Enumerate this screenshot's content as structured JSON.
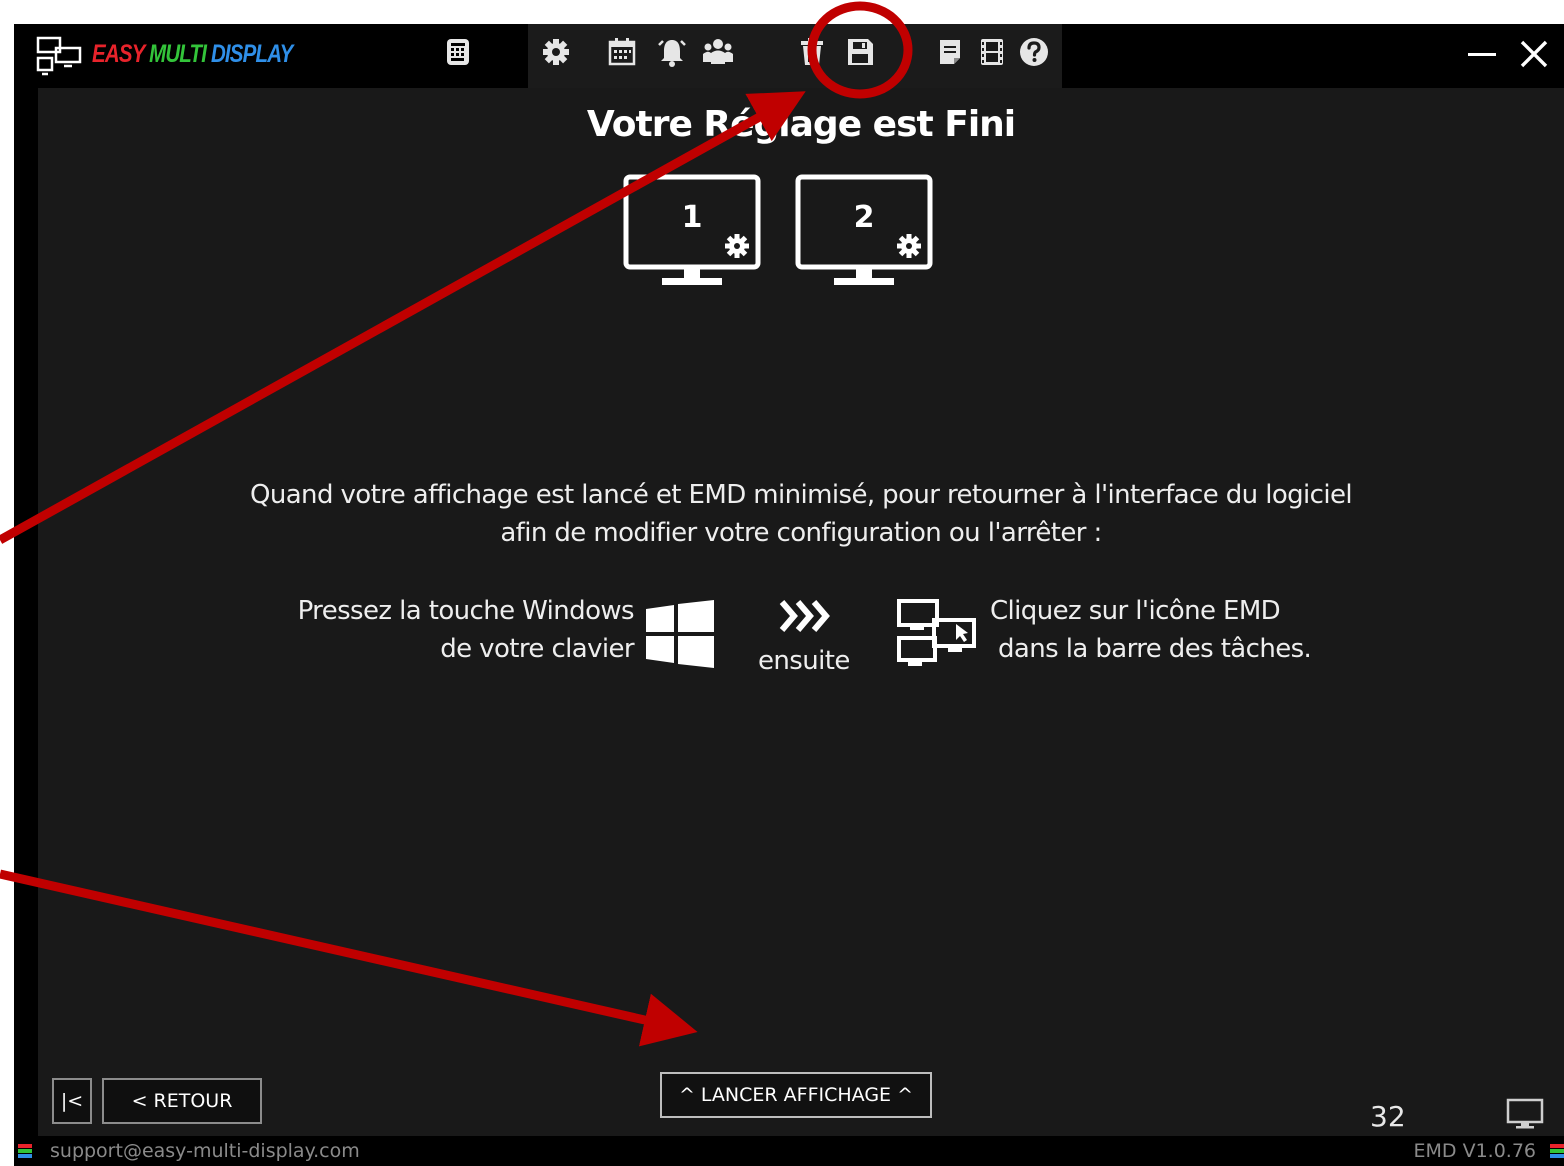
{
  "app": {
    "title_word1": "EASY",
    "title_word2": "MULTI",
    "title_word3": "DISPLAY",
    "brand_colors": {
      "red": "#e8232b",
      "green": "#33c43a",
      "blue": "#2f8fe8"
    }
  },
  "toolbar": {
    "icons": [
      "keypad-icon",
      "gear-icon",
      "calendar-icon",
      "alarm-bell-icon",
      "users-icon",
      "trash-icon",
      "save-icon",
      "note-icon",
      "film-icon",
      "help-icon"
    ],
    "window_controls": [
      "minimize-icon",
      "close-icon"
    ]
  },
  "main": {
    "title": "Votre Réglage est Fini",
    "monitors": [
      "1",
      "2"
    ],
    "paragraph_line1": "Quand votre affichage est lancé et EMD minimisé, pour retourner à l'interface du logiciel",
    "paragraph_line2": "afin de modifier votre configuration ou l'arrêter :",
    "step1_line1": "Pressez la touche Windows",
    "step1_line2": "de votre clavier",
    "then_label": "ensuite",
    "step2_line1": "Cliquez sur l'icône EMD",
    "step2_line2": "dans la barre des tâches."
  },
  "footer": {
    "first_label": "|<",
    "back_label": "< RETOUR",
    "launch_label": "^ LANCER  AFFICHAGE ^",
    "page_number": "32"
  },
  "statusbar": {
    "support_email": "support@easy-multi-display.com",
    "version": "EMD V1.0.76"
  },
  "annotation": {
    "color": "#c00000",
    "highlight": "save-icon",
    "arrow_targets": [
      "save-icon",
      "launch-button"
    ]
  }
}
